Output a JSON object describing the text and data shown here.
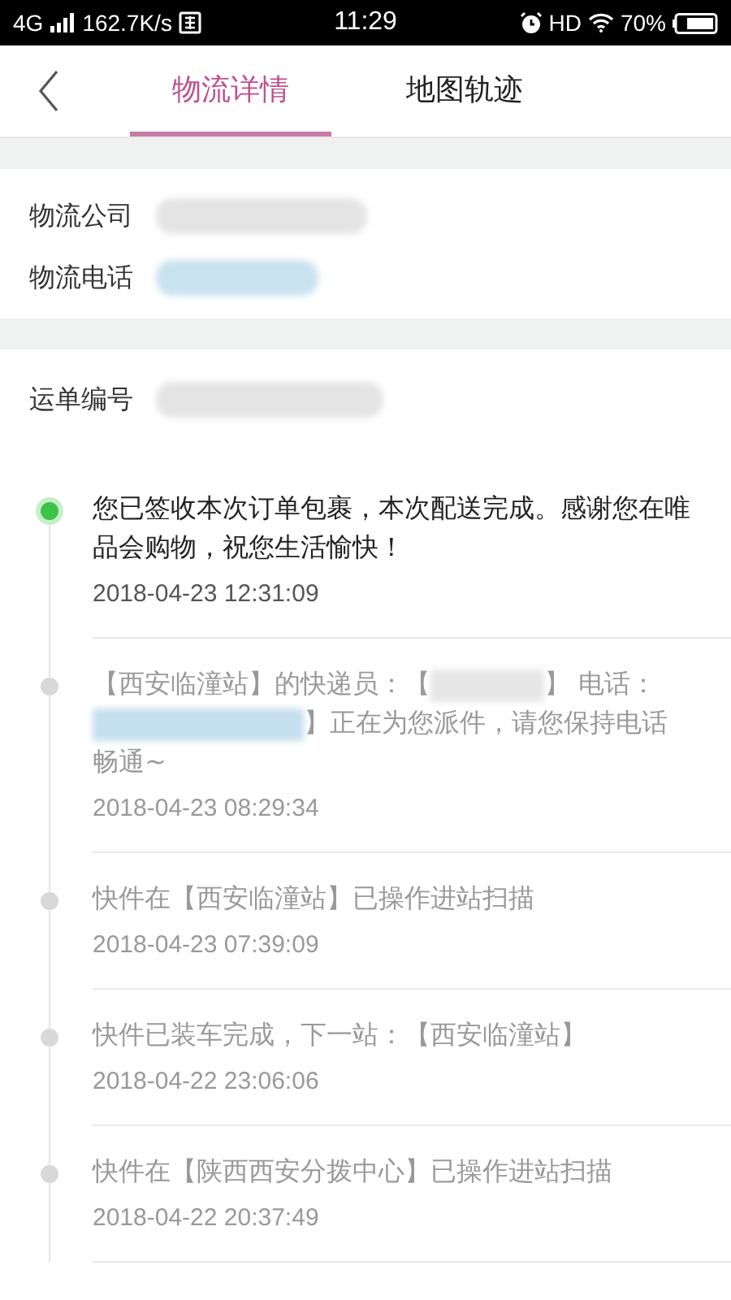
{
  "status_bar": {
    "network": "4G",
    "speed": "162.7K/s",
    "time": "11:29",
    "hd": "HD",
    "battery": "70%"
  },
  "header": {
    "tabs": [
      {
        "label": "物流详情",
        "selected": true
      },
      {
        "label": "地图轨迹",
        "selected": false
      }
    ]
  },
  "logistics": [
    {
      "label": "物流公司",
      "kind": "redacted"
    },
    {
      "label": "物流电话",
      "kind": "redacted_link"
    }
  ],
  "waybill": {
    "label": "运单编号",
    "kind": "redacted"
  },
  "events": [
    {
      "current": true,
      "segments": [
        {
          "kind": "text",
          "text": "您已签收本次订单包裹，本次配送完成。感谢您在唯品会购物，祝您生活愉快！"
        }
      ],
      "time": "2018-04-23 12:31:09"
    },
    {
      "current": false,
      "segments": [
        {
          "kind": "text",
          "text": "【西安临潼站】的快递员：【"
        },
        {
          "kind": "redacted"
        },
        {
          "kind": "text",
          "text": "】 电话："
        },
        {
          "kind": "redacted_link"
        },
        {
          "kind": "text",
          "text": "】正在为您派件，请您保持电话"
        },
        {
          "kind": "text",
          "text": "畅通~"
        }
      ],
      "time": "2018-04-23 08:29:34"
    },
    {
      "current": false,
      "segments": [
        {
          "kind": "text",
          "text": "快件在【西安临潼站】已操作进站扫描"
        }
      ],
      "time": "2018-04-23 07:39:09"
    },
    {
      "current": false,
      "segments": [
        {
          "kind": "text",
          "text": "快件已装车完成，下一站：【西安临潼站】"
        }
      ],
      "time": "2018-04-22 23:06:06"
    },
    {
      "current": false,
      "segments": [
        {
          "kind": "text",
          "text": "快件在【陕西西安分拨中心】已操作进站扫描"
        }
      ],
      "time": "2018-04-22 20:37:49"
    }
  ]
}
